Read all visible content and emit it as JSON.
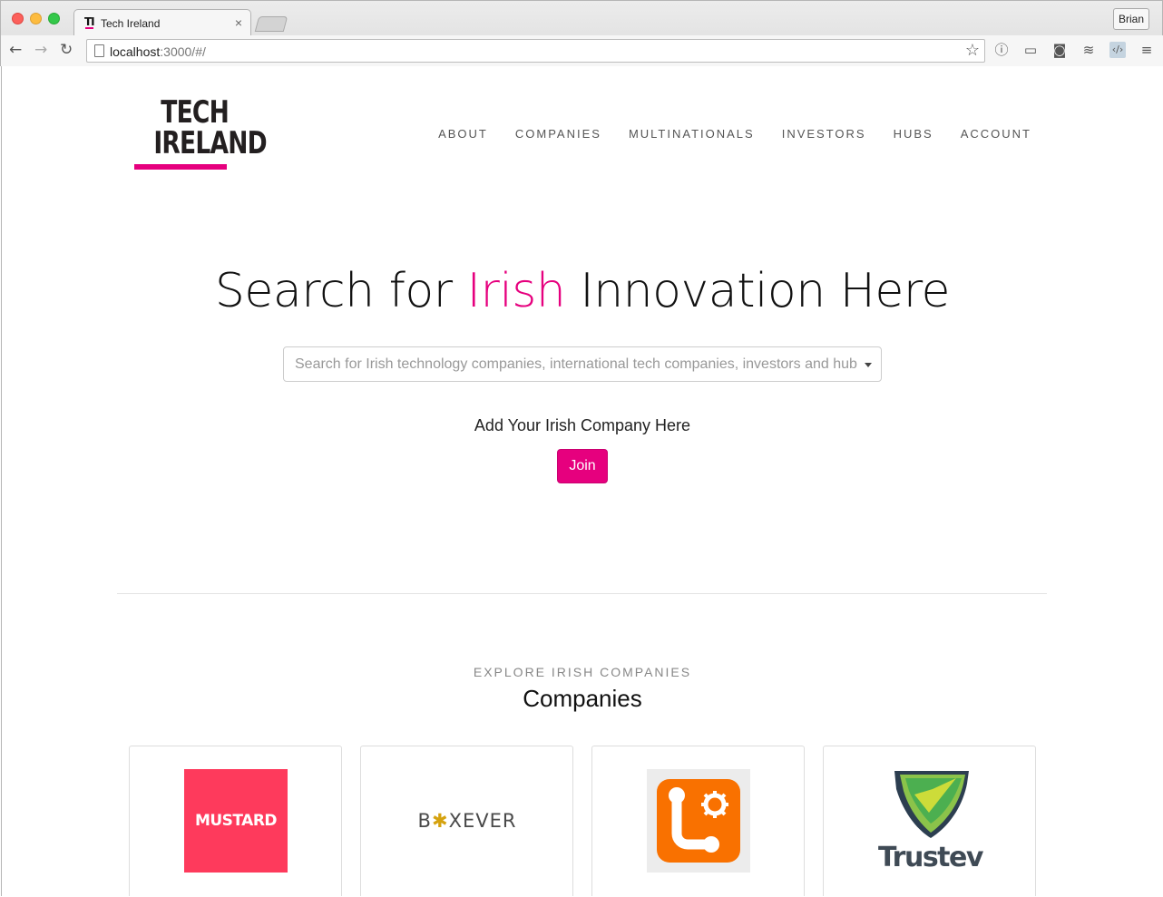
{
  "browser": {
    "tab_title": "Tech Ireland",
    "tab_favicon": "TI",
    "url_host": "localhost",
    "url_rest": ":3000/#/",
    "user": "Brian"
  },
  "header": {
    "logo_line1": "TECH",
    "logo_line2": "IRELAND",
    "nav": [
      "ABOUT",
      "COMPANIES",
      "MULTINATIONALS",
      "INVESTORS",
      "HUBS",
      "ACCOUNT"
    ]
  },
  "hero": {
    "title_before": "Search for ",
    "title_accent": "Irish",
    "title_after": " Innovation Here",
    "search_placeholder": "Search for Irish technology companies, international tech companies, investors and hubs",
    "add_text": "Add Your Irish Company Here",
    "join_label": "Join"
  },
  "explore": {
    "kicker": "EXPLORE IRISH COMPANIES",
    "title": "Companies"
  },
  "companies": [
    {
      "logo_text": "MUSTARD"
    },
    {
      "logo_text_1": "B",
      "logo_text_2": "XEVER"
    },
    {
      "logo": "orange-app-icon"
    },
    {
      "logo_text": "Trustev"
    }
  ],
  "colors": {
    "accent": "#e6007e",
    "mustard": "#fe3a5c",
    "loco_orange": "#f97100"
  }
}
